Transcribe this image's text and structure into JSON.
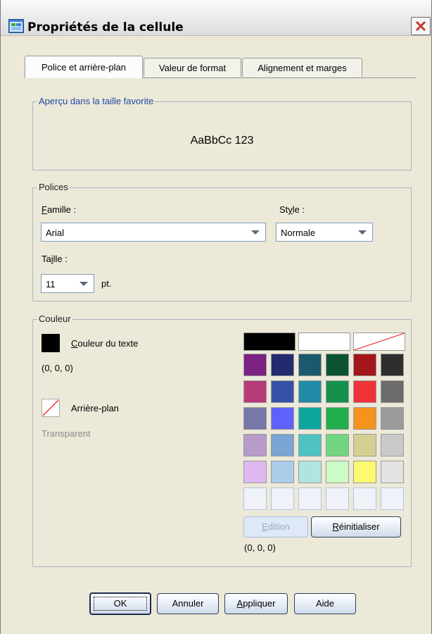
{
  "window": {
    "title": "Propriétés de la cellule"
  },
  "tabs": [
    {
      "label": "Police et arrière-plan"
    },
    {
      "label": "Valeur de format"
    },
    {
      "label": "Alignement et marges"
    }
  ],
  "preview": {
    "legend": "Aperçu dans la taille favorite",
    "sample_text": "AaBbCc 123"
  },
  "fonts": {
    "legend": "Polices",
    "family_label": "Famille :",
    "family_value": "Arial",
    "style_label": "Style :",
    "style_value": "Normale",
    "size_label": "Taille :",
    "size_value": "11",
    "size_unit": "pt."
  },
  "color": {
    "legend": "Couleur",
    "text_color_label": "Couleur du texte",
    "text_color_value": "(0, 0, 0)",
    "text_color_hex": "#000000",
    "background_label": "Arrière-plan",
    "background_value": "Transparent",
    "edit_button": "Edition",
    "reset_button": "Réinitialiser",
    "selected_value": "(0, 0, 0)",
    "palette_top": [
      "#000000",
      "#ffffff",
      "transparent"
    ],
    "palette_rows": [
      [
        "#7b2283",
        "#232a6e",
        "#1b5a6e",
        "#0b5332",
        "#a3171a",
        "#2e2e2e"
      ],
      [
        "#b63b79",
        "#3552a6",
        "#228ba8",
        "#15904c",
        "#ee3339",
        "#6c6c6c"
      ],
      [
        "#7679a8",
        "#5e62fa",
        "#0ea59f",
        "#22ae4a",
        "#f4941e",
        "#9b9b9b"
      ],
      [
        "#b79bc9",
        "#7ba5d3",
        "#4ec2c1",
        "#71d67f",
        "#d6cf94",
        "#c9c9c9"
      ],
      [
        "#ddb9f0",
        "#abcdea",
        "#b1e3e1",
        "#cdfbc6",
        "#fbfa70",
        "#e3e3e3"
      ],
      [
        "#eff2f9",
        "#eff2f9",
        "#eff2f9",
        "#eff2f9",
        "#eff2f9",
        "#eff2f9"
      ]
    ]
  },
  "buttons": {
    "ok": "OK",
    "cancel": "Annuler",
    "apply": "Appliquer",
    "help": "Aide"
  }
}
